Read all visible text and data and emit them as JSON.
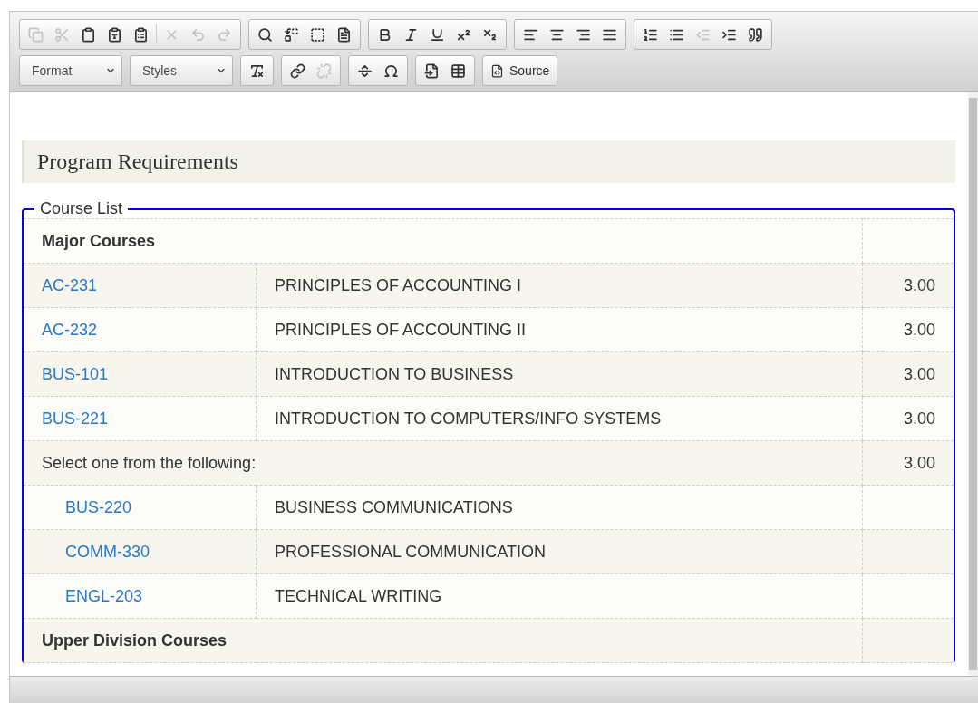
{
  "toolbar": {
    "rows": [
      [
        {
          "buttons": [
            {
              "kind": "copy",
              "disabled": true
            },
            {
              "kind": "cut",
              "disabled": true
            },
            {
              "kind": "paste",
              "disabled": false
            },
            {
              "kind": "paste-text",
              "disabled": false
            },
            {
              "kind": "paste-word",
              "disabled": false
            },
            {
              "kind": "separator"
            },
            {
              "kind": "remove",
              "disabled": true
            },
            {
              "kind": "undo",
              "disabled": true
            },
            {
              "kind": "redo",
              "disabled": true
            }
          ]
        },
        {
          "buttons": [
            {
              "kind": "find",
              "disabled": false
            },
            {
              "kind": "replace",
              "disabled": false
            },
            {
              "kind": "select-all",
              "disabled": false
            },
            {
              "kind": "template",
              "disabled": false
            }
          ]
        },
        {
          "buttons": [
            {
              "kind": "bold",
              "disabled": false
            },
            {
              "kind": "italic",
              "disabled": false
            },
            {
              "kind": "underline",
              "disabled": false
            },
            {
              "kind": "superscript",
              "disabled": false
            },
            {
              "kind": "subscript",
              "disabled": false
            }
          ]
        },
        {
          "buttons": [
            {
              "kind": "align-left",
              "disabled": false
            },
            {
              "kind": "align-center",
              "disabled": false
            },
            {
              "kind": "align-right",
              "disabled": false
            },
            {
              "kind": "justify",
              "disabled": false
            }
          ]
        },
        {
          "buttons": [
            {
              "kind": "numbered-list",
              "disabled": false
            },
            {
              "kind": "bulleted-list",
              "disabled": false
            },
            {
              "kind": "outdent",
              "disabled": true
            },
            {
              "kind": "indent",
              "disabled": false
            },
            {
              "kind": "quote",
              "disabled": false
            }
          ]
        }
      ],
      [
        {
          "dropdowns": [
            {
              "label": "Format"
            },
            {
              "label": "Styles"
            }
          ]
        },
        {
          "buttons": [
            {
              "kind": "clear-format",
              "disabled": false
            }
          ]
        },
        {
          "buttons": [
            {
              "kind": "link",
              "disabled": false
            },
            {
              "kind": "unlink",
              "disabled": true
            }
          ]
        },
        {
          "buttons": [
            {
              "kind": "rule",
              "disabled": false
            },
            {
              "kind": "omega",
              "disabled": false
            }
          ]
        },
        {
          "buttons": [
            {
              "kind": "iframe",
              "disabled": false
            },
            {
              "kind": "table",
              "disabled": false
            }
          ]
        },
        {
          "source": {
            "label": "Source"
          }
        }
      ]
    ]
  },
  "content": {
    "heading": "Program Requirements",
    "legend": "Course List",
    "rows": [
      {
        "kind": "section",
        "title": "Major Courses"
      },
      {
        "kind": "course",
        "code": "AC-231",
        "title": "PRINCIPLES OF ACCOUNTING I",
        "credits": "3.00"
      },
      {
        "kind": "course",
        "code": "AC-232",
        "title": "PRINCIPLES OF ACCOUNTING II",
        "credits": "3.00"
      },
      {
        "kind": "course",
        "code": "BUS-101",
        "title": "INTRODUCTION TO BUSINESS",
        "credits": "3.00"
      },
      {
        "kind": "course",
        "code": "BUS-221",
        "title": "INTRODUCTION TO COMPUTERS/INFO SYSTEMS",
        "credits": "3.00"
      },
      {
        "kind": "choice",
        "title": "Select one from the following:",
        "credits": "3.00"
      },
      {
        "kind": "option",
        "code": "BUS-220",
        "title": "BUSINESS COMMUNICATIONS"
      },
      {
        "kind": "option",
        "code": "COMM-330",
        "title": "PROFESSIONAL COMMUNICATION"
      },
      {
        "kind": "option",
        "code": "ENGL-203",
        "title": "TECHNICAL WRITING"
      },
      {
        "kind": "section",
        "title": "Upper Division Courses"
      }
    ]
  }
}
